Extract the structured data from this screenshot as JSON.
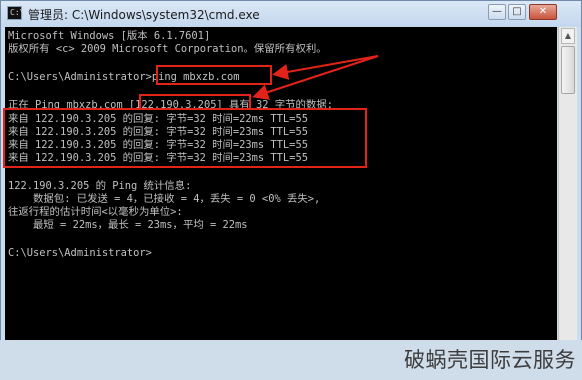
{
  "window": {
    "title": "管理员: C:\\Windows\\system32\\cmd.exe",
    "icon_label": "C:\\",
    "minimize_glyph": "—",
    "maximize_glyph": "□",
    "close_glyph": "✕"
  },
  "console": {
    "lines": [
      "Microsoft Windows [版本 6.1.7601]",
      "版权所有 <c> 2009 Microsoft Corporation。保留所有权利。",
      "",
      "C:\\Users\\Administrator>ping mbxzb.com",
      "",
      "正在 Ping mbxzb.com [122.190.3.205] 具有 32 字节的数据:",
      "来自 122.190.3.205 的回复: 字节=32 时间=22ms TTL=55",
      "来自 122.190.3.205 的回复: 字节=32 时间=23ms TTL=55",
      "来自 122.190.3.205 的回复: 字节=32 时间=23ms TTL=55",
      "来自 122.190.3.205 的回复: 字节=32 时间=23ms TTL=55",
      "",
      "122.190.3.205 的 Ping 统计信息:",
      "    数据包: 已发送 = 4，已接收 = 4，丢失 = 0 <0% 丢失>,",
      "往返行程的估计时间<以毫秒为单位>:",
      "    最短 = 22ms，最长 = 23ms，平均 = 22ms",
      "",
      "C:\\Users\\Administrator>"
    ]
  },
  "annotation_color": "#e2231a",
  "watermark": "破蜗壳国际云服务"
}
